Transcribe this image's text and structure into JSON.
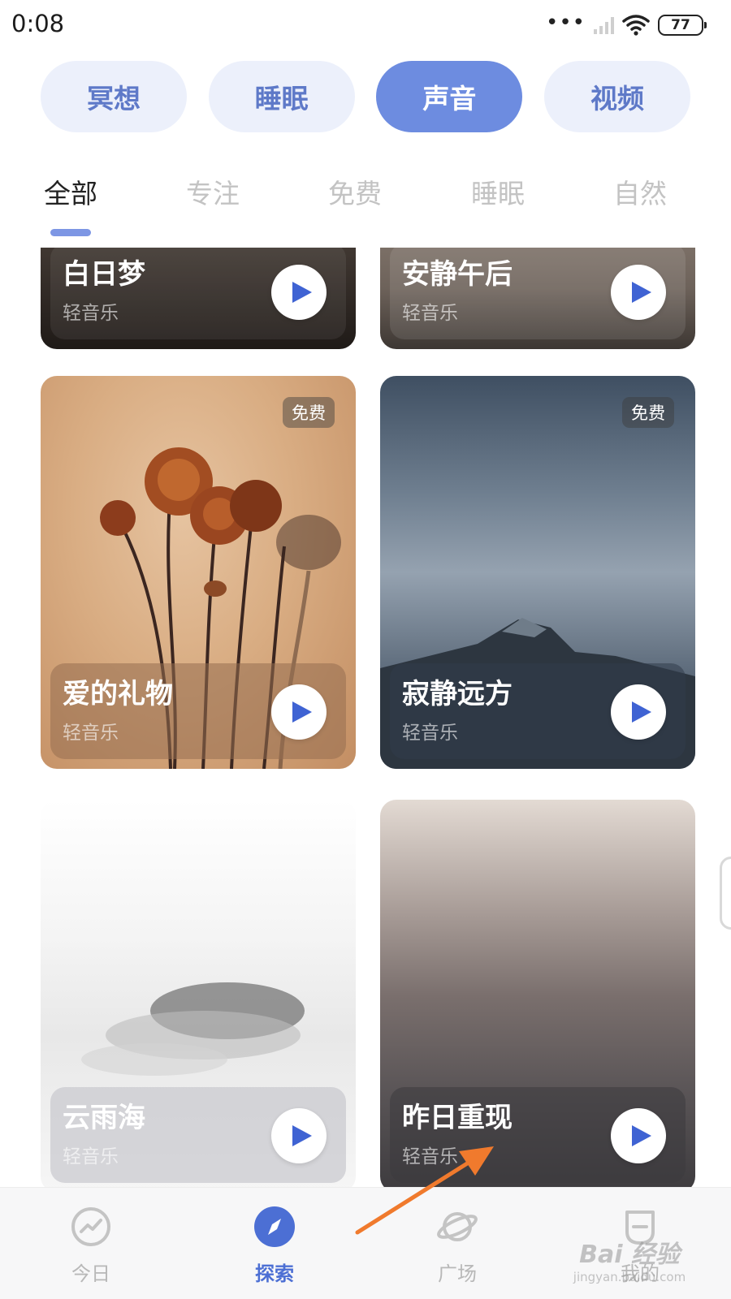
{
  "status_bar": {
    "time": "0:08",
    "battery": "77"
  },
  "categories": [
    {
      "label": "冥想",
      "active": false
    },
    {
      "label": "睡眠",
      "active": false
    },
    {
      "label": "声音",
      "active": true
    },
    {
      "label": "视频",
      "active": false
    }
  ],
  "subtabs": [
    {
      "label": "全部",
      "active": true
    },
    {
      "label": "专注",
      "active": false
    },
    {
      "label": "免费",
      "active": false
    },
    {
      "label": "睡眠",
      "active": false
    },
    {
      "label": "自然",
      "active": false
    }
  ],
  "cards": [
    {
      "title": "白日梦",
      "subtitle": "轻音乐"
    },
    {
      "title": "安静午后",
      "subtitle": "轻音乐"
    },
    {
      "title": "爱的礼物",
      "subtitle": "轻音乐",
      "badge": "免费"
    },
    {
      "title": "寂静远方",
      "subtitle": "轻音乐",
      "badge": "免费"
    },
    {
      "title": "云雨海",
      "subtitle": "轻音乐"
    },
    {
      "title": "昨日重现",
      "subtitle": "轻音乐"
    }
  ],
  "bottom_nav": [
    {
      "label": "今日",
      "icon": "trend-chart-icon",
      "active": false
    },
    {
      "label": "探索",
      "icon": "compass-icon",
      "active": true
    },
    {
      "label": "广场",
      "icon": "planet-icon",
      "active": false
    },
    {
      "label": "我的",
      "icon": "profile-icon",
      "active": false
    }
  ],
  "watermark": {
    "line1": "Bai 经验",
    "line2": "jingyan.baidu.com"
  },
  "colors": {
    "accent": "#6d8ce0",
    "pill_bg": "#ecf0fb",
    "play_icon": "#3f63d3",
    "annotation_arrow": "#f07a2d"
  }
}
